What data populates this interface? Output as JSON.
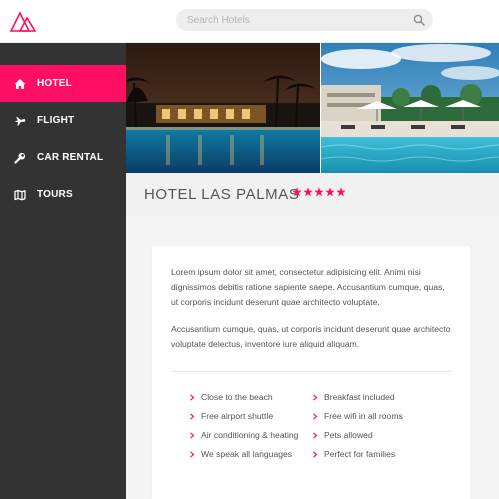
{
  "header": {
    "logo_icon": "mountain-triangle-logo",
    "search": {
      "placeholder": "Search Hotels",
      "value": "",
      "icon": "search-icon"
    }
  },
  "sidebar": {
    "items": [
      {
        "label": "HOTEL",
        "icon": "home-icon",
        "active": true
      },
      {
        "label": "FLIGHT",
        "icon": "airplane-icon",
        "active": false
      },
      {
        "label": "CAR RENTAL",
        "icon": "wrench-icon",
        "active": false
      },
      {
        "label": "TOURS",
        "icon": "map-icon",
        "active": false
      }
    ]
  },
  "gallery": {
    "photos": [
      {
        "subject": "resort pool at night with palm trees"
      },
      {
        "subject": "resort pool by day with umbrellas"
      }
    ]
  },
  "hotel": {
    "name": "HOTEL LAS PALMAS",
    "rating": 5,
    "rating_icon": "star-icon"
  },
  "description": {
    "paragraphs": [
      "Lorem ipsum dolor sit amet, consectetur adipisicing elit. Animi nisi dignissimos debitis ratione sapiente saepe. Accusantium cumque, quas, ut corporis incidunt deserunt quae architecto voluptate.",
      "Accusantium cumque, quas, ut corporis incidunt deserunt quae architecto voluptate delectus, inventore iure aliquid aliquam."
    ]
  },
  "amenities": {
    "left": [
      "Close to the beach",
      "Free airport shuttle",
      "Air conditioning & heating",
      "We speak all languages"
    ],
    "right": [
      "Breakfast included",
      "Free wifi in all rooms",
      "Pets allowed",
      "Perfect for families"
    ]
  },
  "colors": {
    "accent": "#ff0f63",
    "sidebar": "#333333",
    "title_bar": "#f1f1f1",
    "content_bg": "#f4f4f4"
  }
}
